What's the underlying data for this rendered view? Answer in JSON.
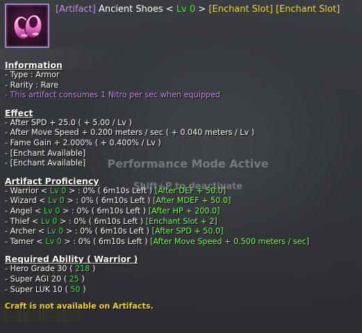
{
  "item": {
    "icon": "ancient-shoes-icon",
    "artifact_tag": "[Artifact]",
    "name": "Ancient Shoes",
    "level_open": "<",
    "level": "Lv 0",
    "level_close": ">",
    "enchant_slot_1": "[Enchant Slot]",
    "enchant_slot_2": "[Enchant Slot]"
  },
  "overlay": {
    "performance_mode": "Performance Mode Active",
    "deactivate_hint": "Shift+P to deactivate"
  },
  "information": {
    "title": "Information",
    "type": "- Type : Armor",
    "rarity": "- Rarity : Rare",
    "consumption": "- This artifact consumes 1 Nitro per sec when equipped"
  },
  "effect": {
    "title": "Effect",
    "lines": [
      "- After SPD + 25.0 ( + 5.00 / Lv )",
      "- After Move Speed + 0.200 meters / sec ( + 0.040 meters / Lv )",
      "- Fame Gain + 2.000% ( + 0.400% / Lv )",
      "- [Enchant Available]",
      "- [Enchant Available]"
    ]
  },
  "proficiency": {
    "title": "Artifact Proficiency",
    "rows": [
      {
        "prefix": "- Warrior <",
        "level": "Lv 0",
        "progress": "> : 0% ( 6m10s Left )",
        "bonus": "[After DEF + 50.0]"
      },
      {
        "prefix": "- Wizard <",
        "level": "Lv 0",
        "progress": "> : 0% ( 6m10s Left )",
        "bonus": "[After MDEF + 50.0]"
      },
      {
        "prefix": "- Angel <",
        "level": "Lv 0",
        "progress": "> : 0% ( 6m10s Left )",
        "bonus": "[After HP + 200.0]"
      },
      {
        "prefix": "- Thief <",
        "level": "Lv 0",
        "progress": "> : 0% ( 6m10s Left )",
        "bonus": "[Enchant Slot + 2]"
      },
      {
        "prefix": "- Archer <",
        "level": "Lv 0",
        "progress": "> : 0% ( 6m10s Left )",
        "bonus": "[After SPD + 50.0]"
      },
      {
        "prefix": "- Tamer <",
        "level": "Lv 0",
        "progress": "> : 0% ( 6m10s Left )",
        "bonus": "[After Move Speed + 0.500 meters / sec]"
      }
    ]
  },
  "required": {
    "title": "Required Ability ( Warrior )",
    "rows": [
      {
        "label": "- Hero Grade 30",
        "open": "(",
        "value": "218",
        "close": ")"
      },
      {
        "label": "- Super AGI 20",
        "open": "(",
        "value": "25",
        "close": ")"
      },
      {
        "label": "- Super LUK 10",
        "open": "(",
        "value": "50",
        "close": ")"
      }
    ]
  },
  "craft_notice": "Craft is not available on Artifacts.",
  "colors": {
    "artifact_tag": "#c98cf2",
    "level": "#3fe83a",
    "enchant_slot": "#f2d230",
    "bonus": "#7cff4c",
    "craft_notice": "#f2d230"
  }
}
